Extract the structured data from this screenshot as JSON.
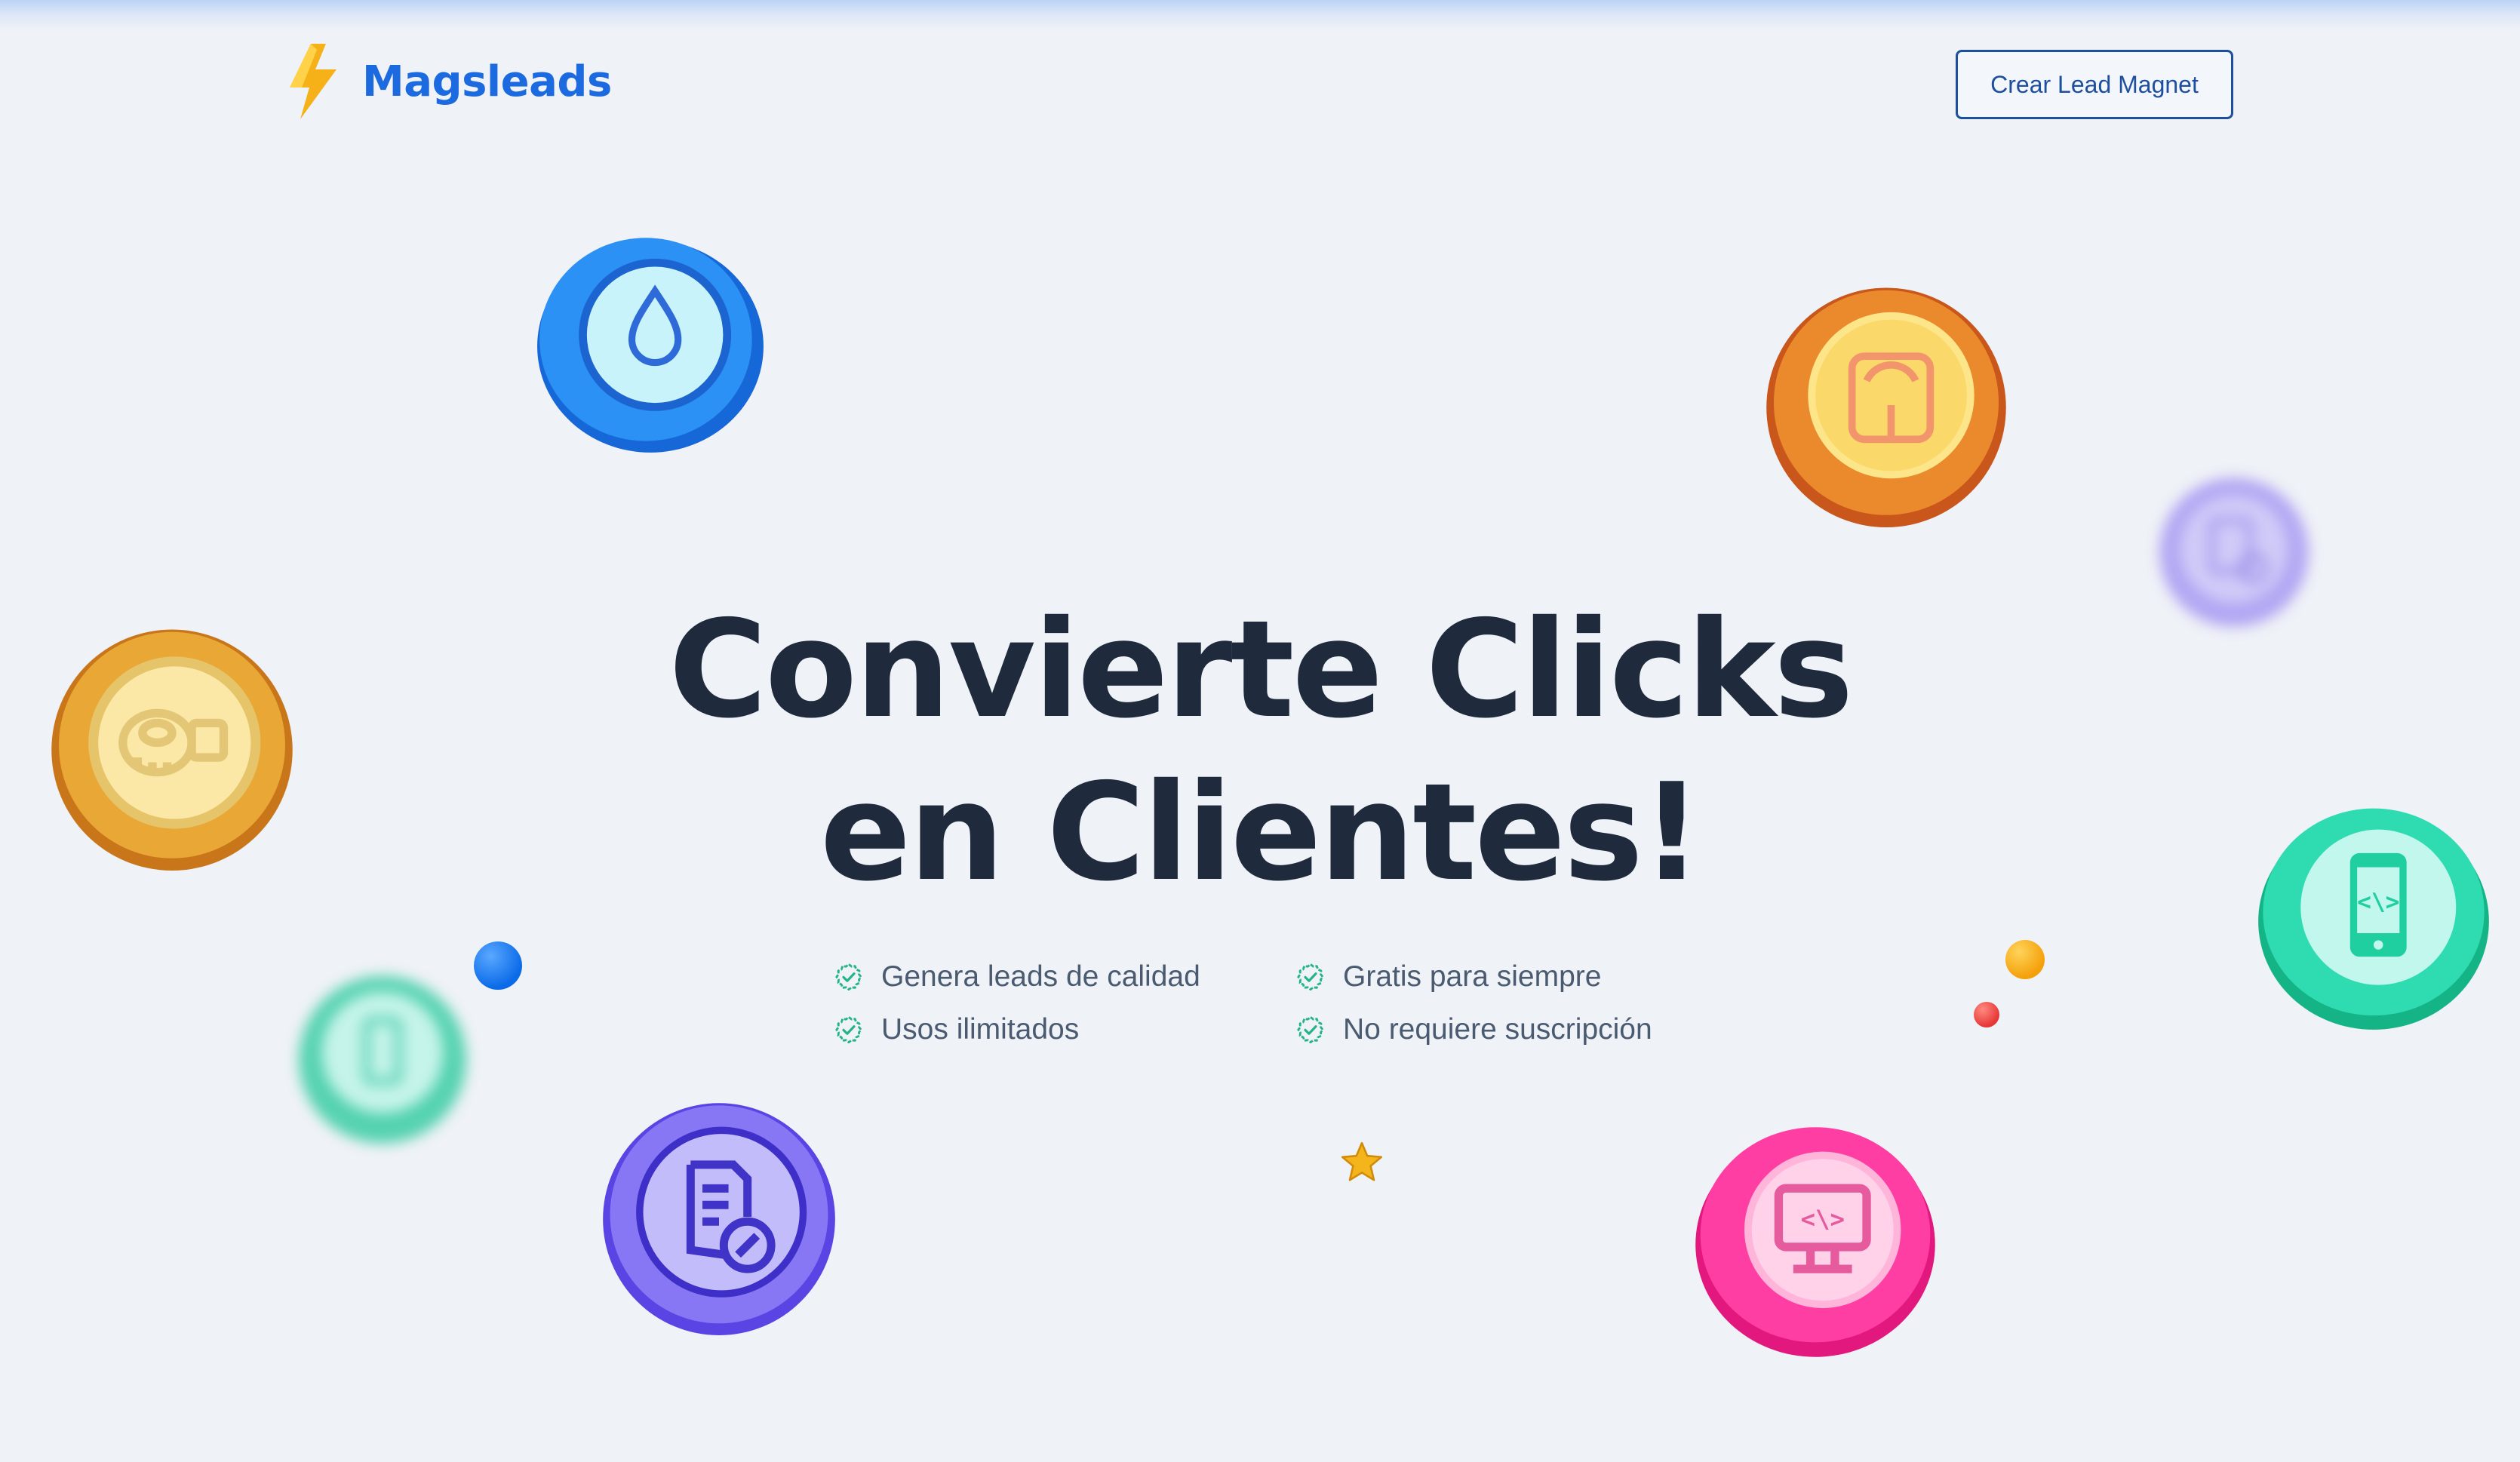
{
  "brand": {
    "name": "Magsleads",
    "logo_icon": "lightning-bolt-icon"
  },
  "header": {
    "cta_label": "Crear Lead Magnet"
  },
  "hero": {
    "title_line1": "Convierte Clicks",
    "title_line2": "en Clientes!"
  },
  "features": [
    {
      "label": "Genera leads de calidad",
      "icon": "check-badge-icon"
    },
    {
      "label": "Gratis para siempre",
      "icon": "check-badge-icon"
    },
    {
      "label": "Usos ilimitados",
      "icon": "check-badge-icon"
    },
    {
      "label": "No requiere suscripción",
      "icon": "check-badge-icon"
    }
  ],
  "decorations": [
    {
      "icon": "water-drop-icon",
      "color": "#1f8cf3"
    },
    {
      "icon": "weighing-scale-icon",
      "color": "#e27a25"
    },
    {
      "icon": "clipboard-icon",
      "color": "#8a7cf0"
    },
    {
      "icon": "measuring-tape-icon",
      "color": "#e8a52a"
    },
    {
      "icon": "mobile-code-icon",
      "color": "#22d2a8"
    },
    {
      "icon": "document-percent-icon",
      "color": "#6d5cf0"
    },
    {
      "icon": "monitor-code-icon",
      "color": "#ff2e9a"
    },
    {
      "icon": "star-icon",
      "color": "#f3b41c"
    }
  ],
  "colors": {
    "background": "#eff2f7",
    "brand_blue": "#1b6ae0",
    "heading": "#1f2b3c",
    "check_green": "#23b38a"
  }
}
